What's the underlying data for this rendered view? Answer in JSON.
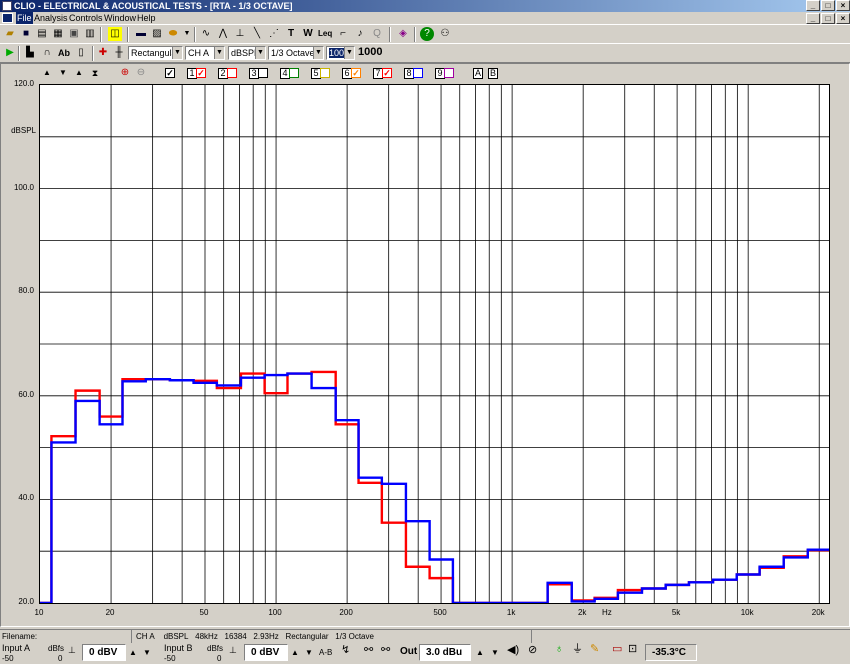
{
  "window": {
    "title": "CLIO - ELECTRICAL & ACOUSTICAL TESTS - [RTA - 1/3 OCTAVE]"
  },
  "menu": {
    "items": [
      "File",
      "Analysis",
      "Controls",
      "Window",
      "Help"
    ]
  },
  "toolbar2": {
    "window_type": "Rectangular",
    "channel": "CH A",
    "unit": "dBSPL",
    "band": "1/3 Octave",
    "averages_selected": "1000",
    "averages_value": "1000"
  },
  "overlays": {
    "numbers": [
      "1",
      "2",
      "3",
      "4",
      "5",
      "6",
      "7",
      "8",
      "9"
    ],
    "checked": [
      true,
      true,
      false,
      false,
      false,
      false,
      true,
      true,
      false,
      false
    ],
    "colors": [
      "#000000",
      "#ff0000",
      "#ff0000",
      "#000000",
      "#008000",
      "#c8b400",
      "#ff8000",
      "#ff0000",
      "#0000ff",
      "#a000a0"
    ],
    "a_label": "A",
    "b_label": "B"
  },
  "chart_data": {
    "type": "line",
    "ylabel": "dBSPL",
    "xlabel": "Hz",
    "yticks": [
      "120.0",
      "100.0",
      "80.0",
      "60.0",
      "40.0",
      "20.0"
    ],
    "xticks": [
      "10",
      "20",
      "50",
      "100",
      "200",
      "500",
      "1k",
      "2k",
      "5k",
      "10k",
      "20k"
    ],
    "ylim": [
      20,
      120
    ],
    "xlim": [
      10,
      22000
    ],
    "x_scale": "log",
    "grid": true,
    "bands": [
      10,
      12.5,
      16,
      20,
      25,
      31.5,
      40,
      50,
      63,
      80,
      100,
      125,
      160,
      200,
      250,
      315,
      400,
      500,
      630,
      800,
      1000,
      1250,
      1600,
      2000,
      2500,
      3150,
      4000,
      5000,
      6300,
      8000,
      10000,
      12500,
      16000,
      20000
    ],
    "series": [
      {
        "color": "#ff0000",
        "values": [
          20.0,
          52.2,
          61.0,
          56.0,
          63.2,
          63.2,
          63.0,
          62.9,
          61.5,
          64.3,
          60.5,
          64.3,
          64.6,
          54.5,
          43.2,
          35.5,
          27.0,
          24.8,
          20.0,
          20.0,
          20.0,
          20.0,
          23.6,
          20.5,
          21.0,
          22.5,
          22.8,
          23.5,
          24.0,
          24.5,
          25.5,
          26.8,
          29.0,
          30.2
        ]
      },
      {
        "color": "#0000ff",
        "values": [
          20.0,
          51.0,
          59.0,
          54.5,
          62.8,
          63.2,
          63.0,
          62.5,
          62.0,
          63.5,
          64.0,
          64.3,
          61.5,
          55.3,
          44.2,
          43.0,
          35.8,
          28.4,
          20.0,
          20.0,
          20.0,
          20.0,
          23.9,
          20.3,
          20.8,
          22.0,
          22.8,
          23.5,
          24.0,
          24.5,
          25.5,
          27.0,
          28.8,
          30.3
        ]
      }
    ]
  },
  "status": {
    "filename_label": "Filename:",
    "info": [
      "CH A",
      "dBSPL",
      "48kHz",
      "16384",
      "2.93Hz",
      "Rectangular",
      "1/3 Octave"
    ]
  },
  "bottom": {
    "input_a_label": "Input A",
    "input_a_scale": "-50",
    "dbfs_label": "dBfs",
    "dbfs_zero": "0",
    "input_a_value": "0 dBV",
    "input_b_label": "Input B",
    "input_b_scale": "-50",
    "input_b_value": "0 dBV",
    "ab_label": "A-B",
    "out_label": "Out",
    "out_value": "3.0 dBu",
    "temperature": "-35.3°C"
  }
}
